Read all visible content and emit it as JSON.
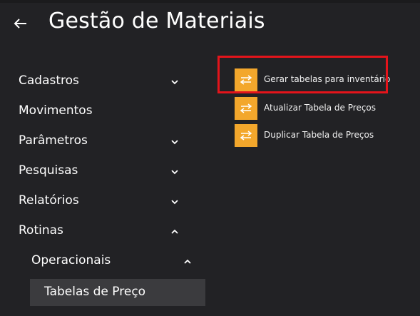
{
  "header": {
    "back_icon": "arrow-left-icon",
    "title": "Gestão de Materiais"
  },
  "nav": {
    "items": [
      {
        "label": "Cadastros",
        "icon": "chevron-down-icon"
      },
      {
        "label": "Movimentos"
      },
      {
        "label": "Parâmetros",
        "icon": "chevron-down-icon"
      },
      {
        "label": "Pesquisas",
        "icon": "chevron-down-icon"
      },
      {
        "label": "Relatórios",
        "icon": "chevron-down-icon"
      },
      {
        "label": "Rotinas",
        "icon": "chevron-up-icon"
      }
    ],
    "subgroup": {
      "label": "Operacionais",
      "icon": "chevron-up-icon"
    },
    "selected": {
      "label": "Tabelas de Preço"
    }
  },
  "actions": [
    {
      "label": "Gerar tabelas para inventário",
      "icon": "swap-arrows-icon"
    },
    {
      "label": "Atualizar Tabela de Preços",
      "icon": "swap-arrows-icon"
    },
    {
      "label": "Duplicar Tabela de Preços",
      "icon": "swap-arrows-icon"
    }
  ],
  "colors": {
    "background": "#222225",
    "accent": "#f3a72c",
    "highlight_border": "#e4141b",
    "selected_item": "#3b3b3e"
  }
}
